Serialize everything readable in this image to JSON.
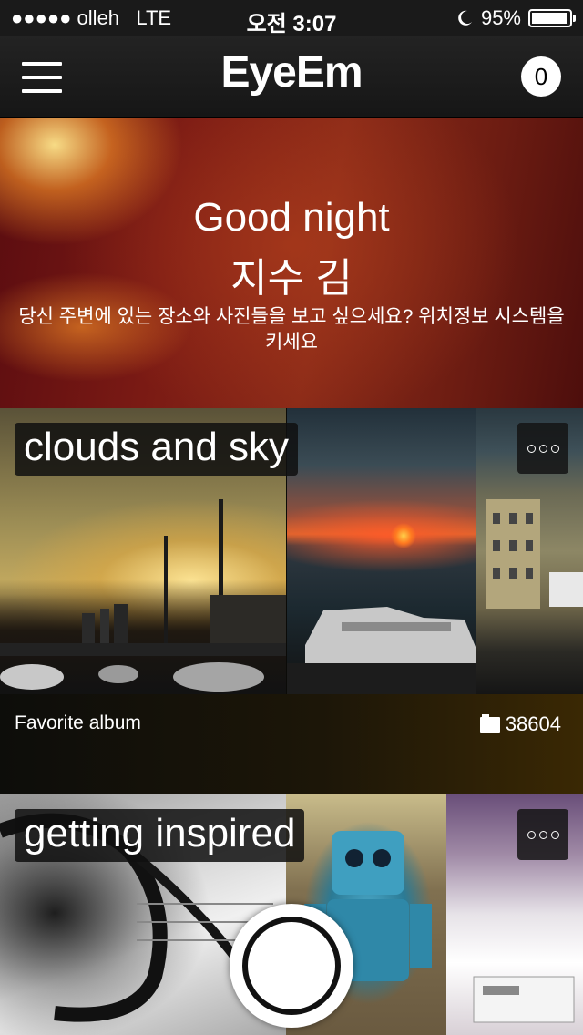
{
  "status_bar": {
    "carrier": "●●●●● olleh",
    "network": "LTE",
    "time": "오전 3:07",
    "battery": "95%",
    "battery_level": 0.95
  },
  "nav": {
    "title": "EyeEm",
    "notification_count": "0",
    "menu_icon": "hamburger-icon"
  },
  "greeting": {
    "line1": "Good night",
    "line2": "지수 김",
    "message": "당신 주변에 있는 장소와 사진들을 보고 싶으세요? 위치정보 시스템을 키세요"
  },
  "albums": [
    {
      "title": "clouds and sky",
      "subtitle": "Favorite album",
      "count": "38604"
    },
    {
      "title": "getting inspired"
    }
  ],
  "icons": {
    "more": "more-options-icon",
    "photo": "photo-count-icon",
    "camera": "camera-shutter-icon",
    "moon": "moon-icon",
    "battery": "battery-icon"
  }
}
